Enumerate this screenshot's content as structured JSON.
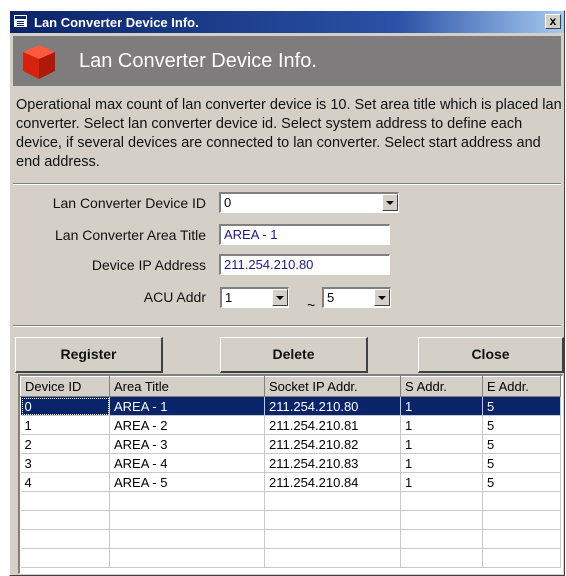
{
  "window": {
    "title": "Lan Converter Device Info.",
    "close_label": "x"
  },
  "banner": {
    "title": "Lan Converter Device Info.",
    "icon": "red-cube-icon"
  },
  "description": "Operational max count of lan converter device is 10. Set area title which is placed lan converter. Select lan converter device id. Select system address to define each device, if several devices are connected to lan converter. Select start address and end address.",
  "form": {
    "device_id_label": "Lan Converter Device ID",
    "device_id_value": "0",
    "area_title_label": "Lan Converter Area Title",
    "area_title_value": "AREA - 1",
    "ip_label": "Device IP Address",
    "ip_value": "211.254.210.80",
    "acu_label": "ACU Addr",
    "acu_start": "1",
    "acu_separator": "~",
    "acu_end": "5"
  },
  "buttons": {
    "register": "Register",
    "delete": "Delete",
    "close": "Close"
  },
  "table": {
    "columns": [
      "Device ID",
      "Area Title",
      "Socket IP Addr.",
      "S Addr.",
      "E Addr."
    ],
    "rows": [
      [
        "0",
        "AREA - 1",
        "211.254.210.80",
        "1",
        "5"
      ],
      [
        "1",
        "AREA - 2",
        "211.254.210.81",
        "1",
        "5"
      ],
      [
        "2",
        "AREA - 3",
        "211.254.210.82",
        "1",
        "5"
      ],
      [
        "3",
        "AREA - 4",
        "211.254.210.83",
        "1",
        "5"
      ],
      [
        "4",
        "AREA - 5",
        "211.254.210.84",
        "1",
        "5"
      ],
      [
        "",
        "",
        "",
        "",
        ""
      ],
      [
        "",
        "",
        "",
        "",
        ""
      ],
      [
        "",
        "",
        "",
        "",
        ""
      ],
      [
        "",
        "",
        "",
        "",
        ""
      ]
    ],
    "selected_row": 0
  },
  "colors": {
    "selection": "#0a246a",
    "banner": "#7e7c7d",
    "face": "#d4d0c8"
  }
}
